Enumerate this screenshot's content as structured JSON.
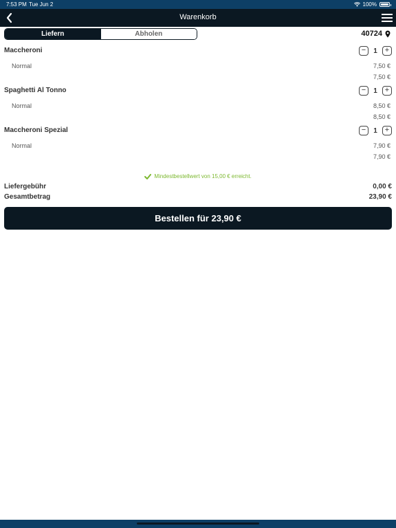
{
  "status": {
    "time": "7:53 PM",
    "date": "Tue Jun 2",
    "battery": "100%"
  },
  "header": {
    "title": "Warenkorb",
    "back_icon": "chevron-left-icon",
    "menu_icon": "hamburger-menu-icon"
  },
  "mode": {
    "options": [
      "Liefern",
      "Abholen"
    ],
    "selected": "Liefern"
  },
  "location": {
    "zip": "40724",
    "icon": "map-pin-icon"
  },
  "cart": {
    "items": [
      {
        "name": "Maccheroni",
        "quantity": "1",
        "variant": "Normal",
        "variant_price": "7,50 €",
        "item_total": "7,50 €"
      },
      {
        "name": "Spaghetti Al Tonno",
        "quantity": "1",
        "variant": "Normal",
        "variant_price": "8,50 €",
        "item_total": "8,50 €"
      },
      {
        "name": "Maccheroni Spezial",
        "quantity": "1",
        "variant": "Normal",
        "variant_price": "7,90 €",
        "item_total": "7,90 €"
      }
    ],
    "decrement_symbol": "−",
    "increment_symbol": "+"
  },
  "min_order_message": "Mindestbestellwert von 15,00 € erreicht.",
  "summary": {
    "delivery_fee_label": "Liefergebühr",
    "delivery_fee": "0,00 €",
    "total_label": "Gesamtbetrag",
    "total": "23,90 €"
  },
  "order_button_label": "Bestellen für 23,90 €",
  "colors": {
    "nav": "#0b1822",
    "status_bar": "#0d3f66",
    "success": "#7cb82f"
  }
}
